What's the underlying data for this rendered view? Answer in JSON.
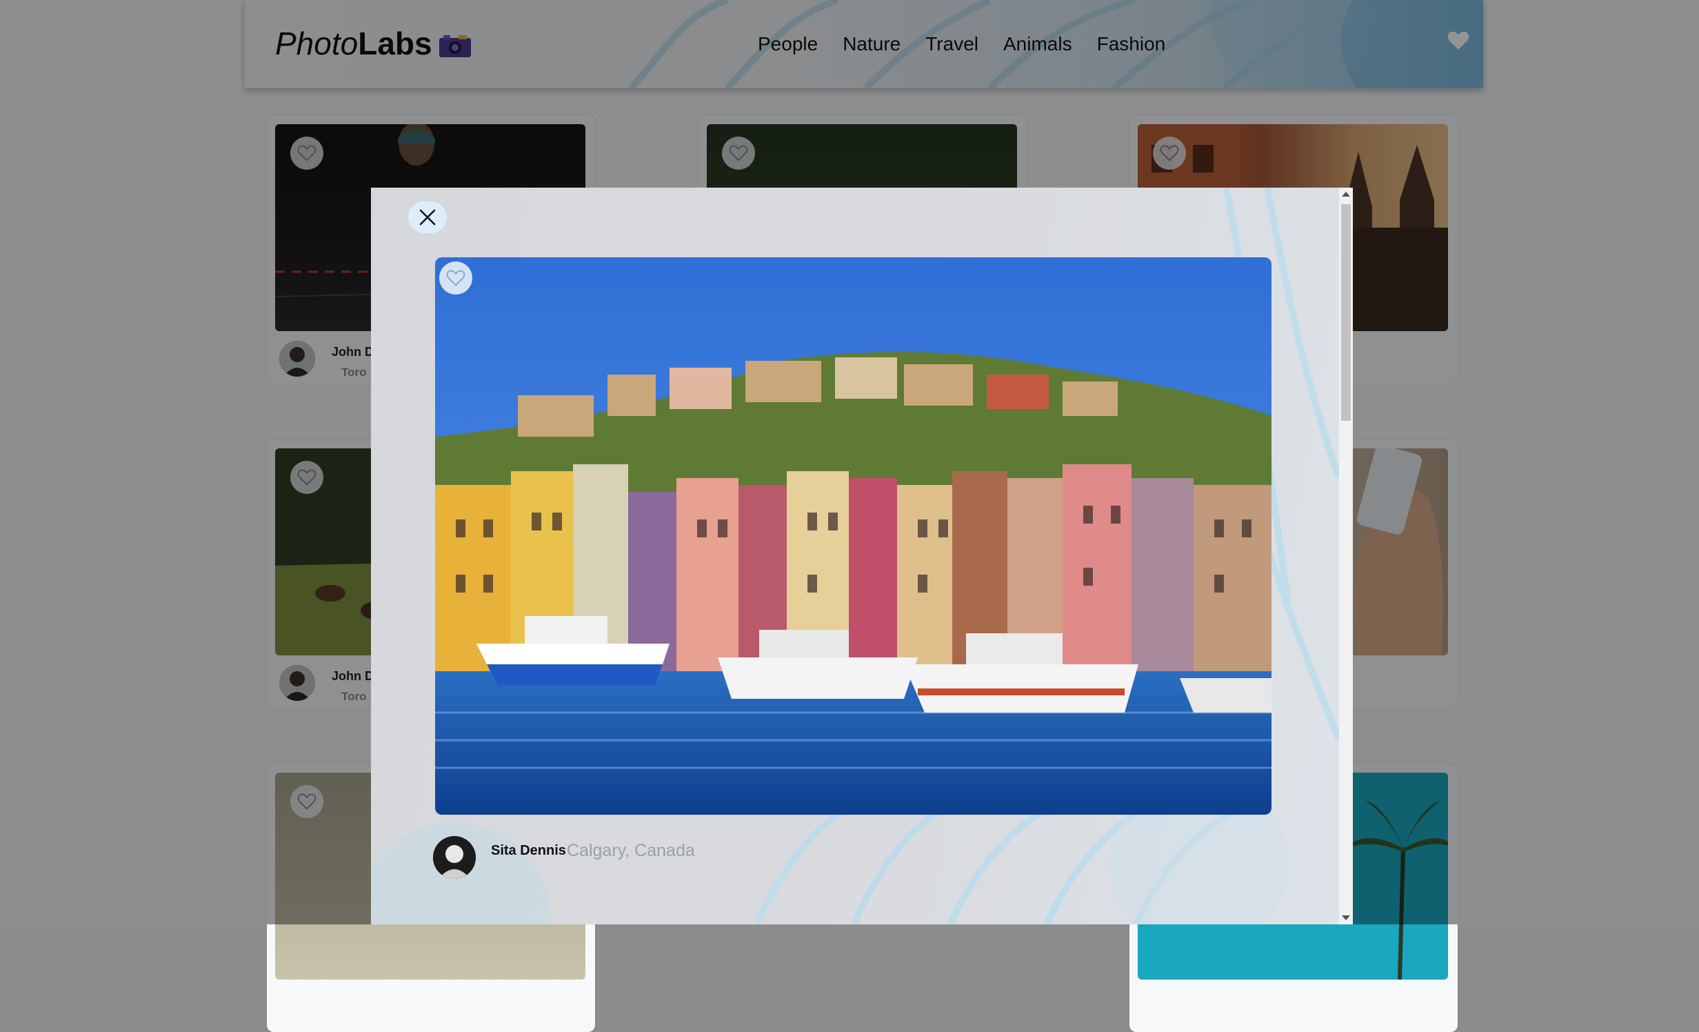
{
  "nav": {
    "logo_part1": "Photo",
    "logo_part2": "Labs",
    "topics": [
      "People",
      "Nature",
      "Travel",
      "Animals",
      "Fashion"
    ]
  },
  "grid": {
    "cards": [
      {
        "name": "John D",
        "location": "Toro"
      },
      {
        "name": "John D",
        "location": "Toro"
      }
    ]
  },
  "modal": {
    "user_name": "Sita Dennis",
    "user_location": "Calgary, Canada"
  },
  "icons": {
    "close": "close-icon",
    "favourite": "heart-icon",
    "camera": "camera-icon"
  },
  "colors": {
    "accent": "#dceefa",
    "nav_gradient_end": "#86bfe0"
  }
}
